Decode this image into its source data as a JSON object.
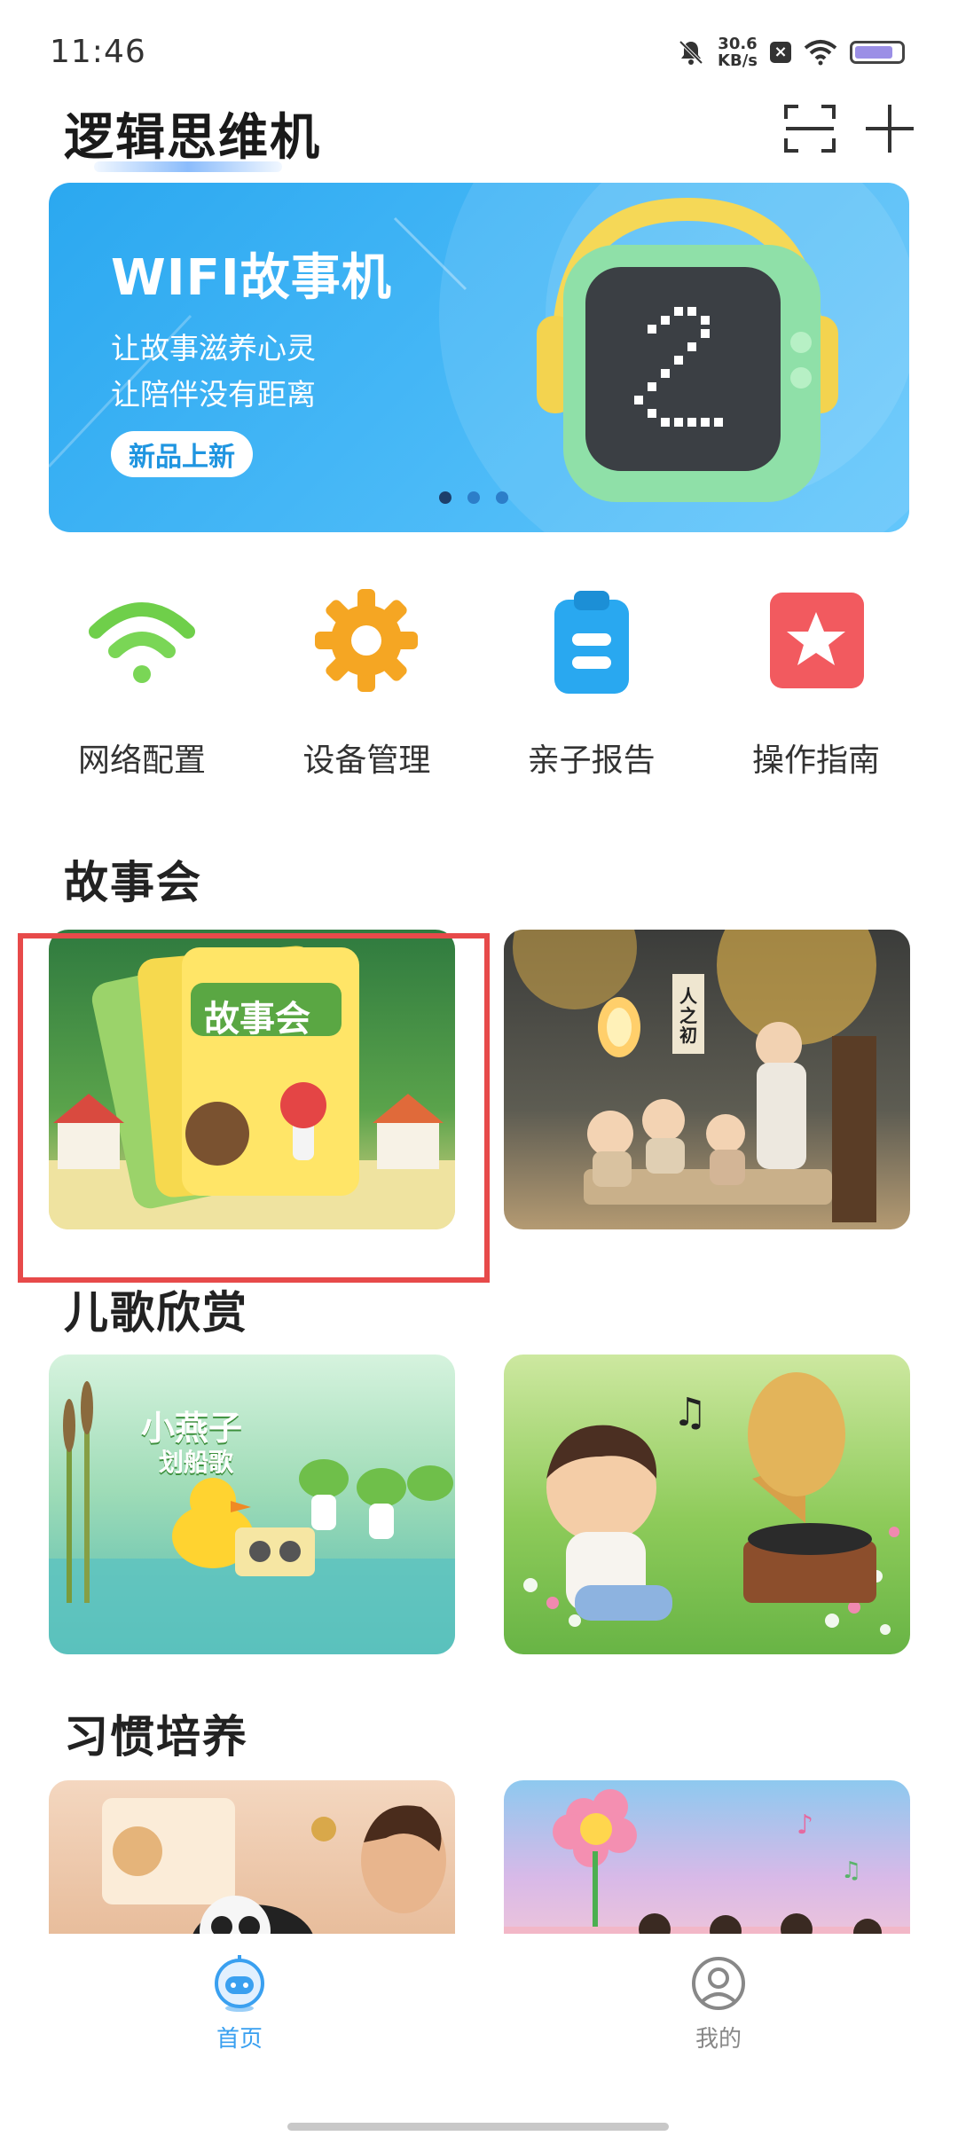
{
  "status": {
    "time": "11:46",
    "speed_value": "30.6",
    "speed_unit": "KB/s"
  },
  "header": {
    "title": "逻辑思维机"
  },
  "banner": {
    "title": "WIFI故事机",
    "line1": "让故事滋养心灵",
    "line2": "让陪伴没有距离",
    "badge": "新品上新"
  },
  "quick_actions": [
    {
      "label": "网络配置",
      "icon": "wifi-icon"
    },
    {
      "label": "设备管理",
      "icon": "gear-icon"
    },
    {
      "label": "亲子报告",
      "icon": "clipboard-icon"
    },
    {
      "label": "操作指南",
      "icon": "star-icon"
    }
  ],
  "sections": {
    "stories": {
      "title": "故事会",
      "card1_caption": "故事会",
      "card2_caption": "人之初"
    },
    "songs": {
      "title": "儿歌欣赏",
      "card1_caption1": "小燕子",
      "card1_caption2": "划船歌"
    },
    "habits": {
      "title": "习惯培养"
    }
  },
  "nav": {
    "home": "首页",
    "me": "我的"
  },
  "colors": {
    "accent": "#3aa0f0",
    "banner": "#2ba8f0",
    "highlight_frame": "#e74a4a"
  }
}
